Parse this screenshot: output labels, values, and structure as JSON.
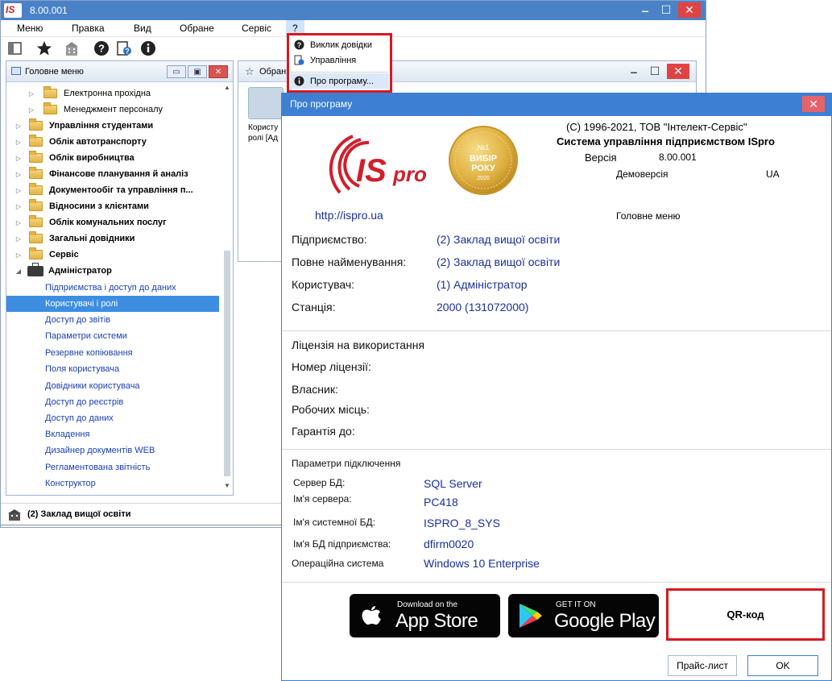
{
  "app": {
    "title": "8.00.001",
    "logo_text": "IS"
  },
  "menubar": {
    "items": [
      "Меню",
      "Правка",
      "Вид",
      "Обране",
      "Сервіс",
      "?"
    ]
  },
  "help_menu": {
    "items": [
      "Виклик довідки",
      "Управління",
      "Про програму..."
    ]
  },
  "tree_panel": {
    "title": "Головне меню",
    "nodes": [
      {
        "label": "Електронна прохідна",
        "level": 1,
        "bold": false
      },
      {
        "label": "Менеджмент персоналу",
        "level": 1,
        "bold": false
      },
      {
        "label": "Управління студентами",
        "level": 0,
        "bold": true
      },
      {
        "label": "Облік автотранспорту",
        "level": 0,
        "bold": true
      },
      {
        "label": "Облік виробництва",
        "level": 0,
        "bold": true
      },
      {
        "label": "Фінансове планування й аналіз",
        "level": 0,
        "bold": true
      },
      {
        "label": "Документообіг та управління п...",
        "level": 0,
        "bold": true
      },
      {
        "label": "Відносини з клієнтами",
        "level": 0,
        "bold": true
      },
      {
        "label": "Облік комунальних послуг",
        "level": 0,
        "bold": true
      },
      {
        "label": "Загальні довідники",
        "level": 0,
        "bold": true
      },
      {
        "label": "Сервіс",
        "level": 0,
        "bold": true
      },
      {
        "label": "Адміністратор",
        "level": 0,
        "bold": true,
        "expanded": true
      },
      {
        "label": "Підприємства і доступ до даних",
        "level": 2
      },
      {
        "label": "Користувачі і ролі",
        "level": 2,
        "selected": true
      },
      {
        "label": "Доступ до звітів",
        "level": 2
      },
      {
        "label": "Параметри системи",
        "level": 2
      },
      {
        "label": "Резервне копіювання",
        "level": 2
      },
      {
        "label": "Поля користувача",
        "level": 2
      },
      {
        "label": "Довідники користувача",
        "level": 2
      },
      {
        "label": "Доступ до реєстрів",
        "level": 2
      },
      {
        "label": "Доступ до даних",
        "level": 2
      },
      {
        "label": "Вкладення",
        "level": 2
      },
      {
        "label": "Дизайнер документів WEB",
        "level": 2
      },
      {
        "label": "Регламентована звітність",
        "level": 2
      },
      {
        "label": "Конструктор",
        "level": 2
      }
    ]
  },
  "favorites": {
    "title": "Обран",
    "tile_label_1": "Користу",
    "tile_label_2": "ролі [Ад"
  },
  "status": {
    "text": "(2) Заклад вищої освіти"
  },
  "about": {
    "title": "Про програму",
    "copyright": "(C) 1996-2021, ТОВ \"Інтелект-Сервіс\"",
    "product": "Система управління підприємством ISpro",
    "version_label": "Версія",
    "version_value": "8.00.001",
    "edition": "Демоверсія",
    "locale": "UA",
    "menu_name": "Головне меню",
    "site": "http://ispro.ua",
    "logo_text": "ISpro",
    "medal": {
      "line1": "№1",
      "line2": "ВИБІР",
      "line3": "РОКУ",
      "line4": "2020"
    },
    "rows": [
      {
        "label": "Підприємство:",
        "value": "(2) Заклад вищої освіти"
      },
      {
        "label": "Повне найменування:",
        "value": "(2) Заклад вищої освіти"
      },
      {
        "label": "Користувач:",
        "value": "(1) Адміністратор"
      },
      {
        "label": "Станція:",
        "value": "2000 (131072000)"
      }
    ],
    "license": {
      "heading": "Ліцензія на використання",
      "number_label": "Номер ліцензії:",
      "owner_label": "Власник:",
      "seats_label": "Робочих місць:",
      "warranty_label": "Гарантія до:"
    },
    "connection": {
      "heading": "Параметри підключення",
      "items": [
        {
          "label": "Сервер БД:",
          "value": "SQL Server"
        },
        {
          "label": "Ім'я сервера:",
          "value": "PC418"
        },
        {
          "label": "Ім'я системної БД:",
          "value": "ISPRO_8_SYS"
        },
        {
          "label": "Ім'я БД підприємства:",
          "value": "dfirm0020"
        },
        {
          "label": "Операційна система",
          "value": "Windows 10 Enterprise"
        }
      ]
    },
    "app_store": {
      "small": "Download on the",
      "big": "App Store"
    },
    "google_play": {
      "small": "GET IT ON",
      "big": "Google Play"
    },
    "qr_label": "QR-код",
    "price_button": "Прайс-лист",
    "ok_button": "OK"
  },
  "colors": {
    "title_bar": "#4a82c8",
    "dialog_title": "#3d7fd2",
    "highlight": "#d7191f",
    "link": "#1b2fa0",
    "selection": "#3d8ee0"
  }
}
